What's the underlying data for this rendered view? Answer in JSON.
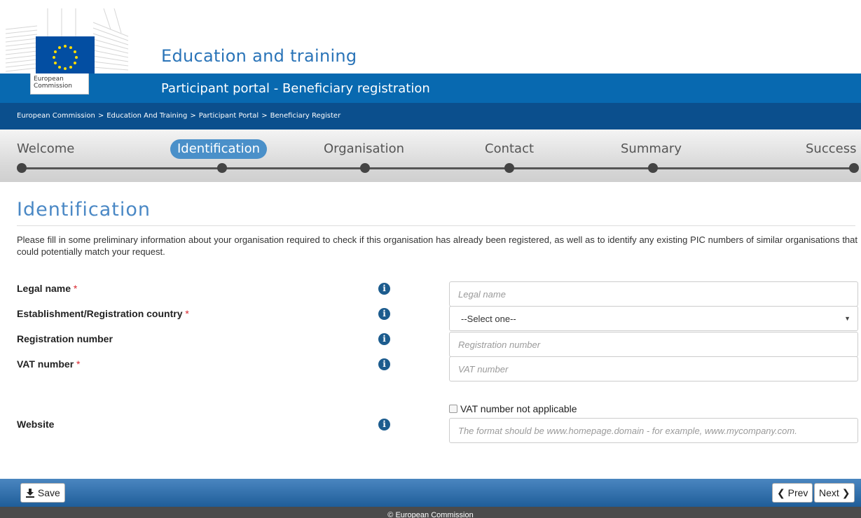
{
  "header": {
    "logo_text_line1": "European",
    "logo_text_line2": "Commission",
    "site_title": "Education and training",
    "subtitle": "Participant portal - Beneficiary registration",
    "breadcrumb": [
      "European Commission",
      "Education And Training",
      "Participant Portal",
      "Beneficiary Register"
    ],
    "breadcrumb_separator": ">"
  },
  "steps": [
    {
      "label": "Welcome",
      "active": false
    },
    {
      "label": "Identification",
      "active": true
    },
    {
      "label": "Organisation",
      "active": false
    },
    {
      "label": "Contact",
      "active": false
    },
    {
      "label": "Summary",
      "active": false
    },
    {
      "label": "Success",
      "active": false
    }
  ],
  "main": {
    "title": "Identification",
    "intro": "Please fill in some preliminary information about your organisation required to check if this organisation has already been registered, as well as to identify any existing PIC numbers of similar organisations that could potentially match your request."
  },
  "form": {
    "required_marker": "*",
    "legal_name": {
      "label": "Legal name",
      "placeholder": "Legal name",
      "required": true
    },
    "country": {
      "label": "Establishment/Registration country",
      "selected": "--Select one--",
      "required": true
    },
    "registration_number": {
      "label": "Registration number",
      "placeholder": "Registration number",
      "required": false
    },
    "vat_number": {
      "label": "VAT number",
      "placeholder": "VAT number",
      "required": true
    },
    "vat_not_applicable": {
      "label": "VAT number not applicable",
      "checked": false
    },
    "website": {
      "label": "Website",
      "placeholder": "The format should be www.homepage.domain - for example, www.mycompany.com.",
      "required": false
    },
    "info_icon_glyph": "i"
  },
  "actions": {
    "save_label": "Save",
    "prev_label": "Prev",
    "next_label": "Next"
  },
  "footer": {
    "text": "© European Commission"
  },
  "colors": {
    "primary_blue": "#0869b0",
    "breadcrumb_blue": "#0b4f8d",
    "active_step": "#4a90c9",
    "title_blue": "#4a88c5",
    "required_red": "#d9262e"
  }
}
